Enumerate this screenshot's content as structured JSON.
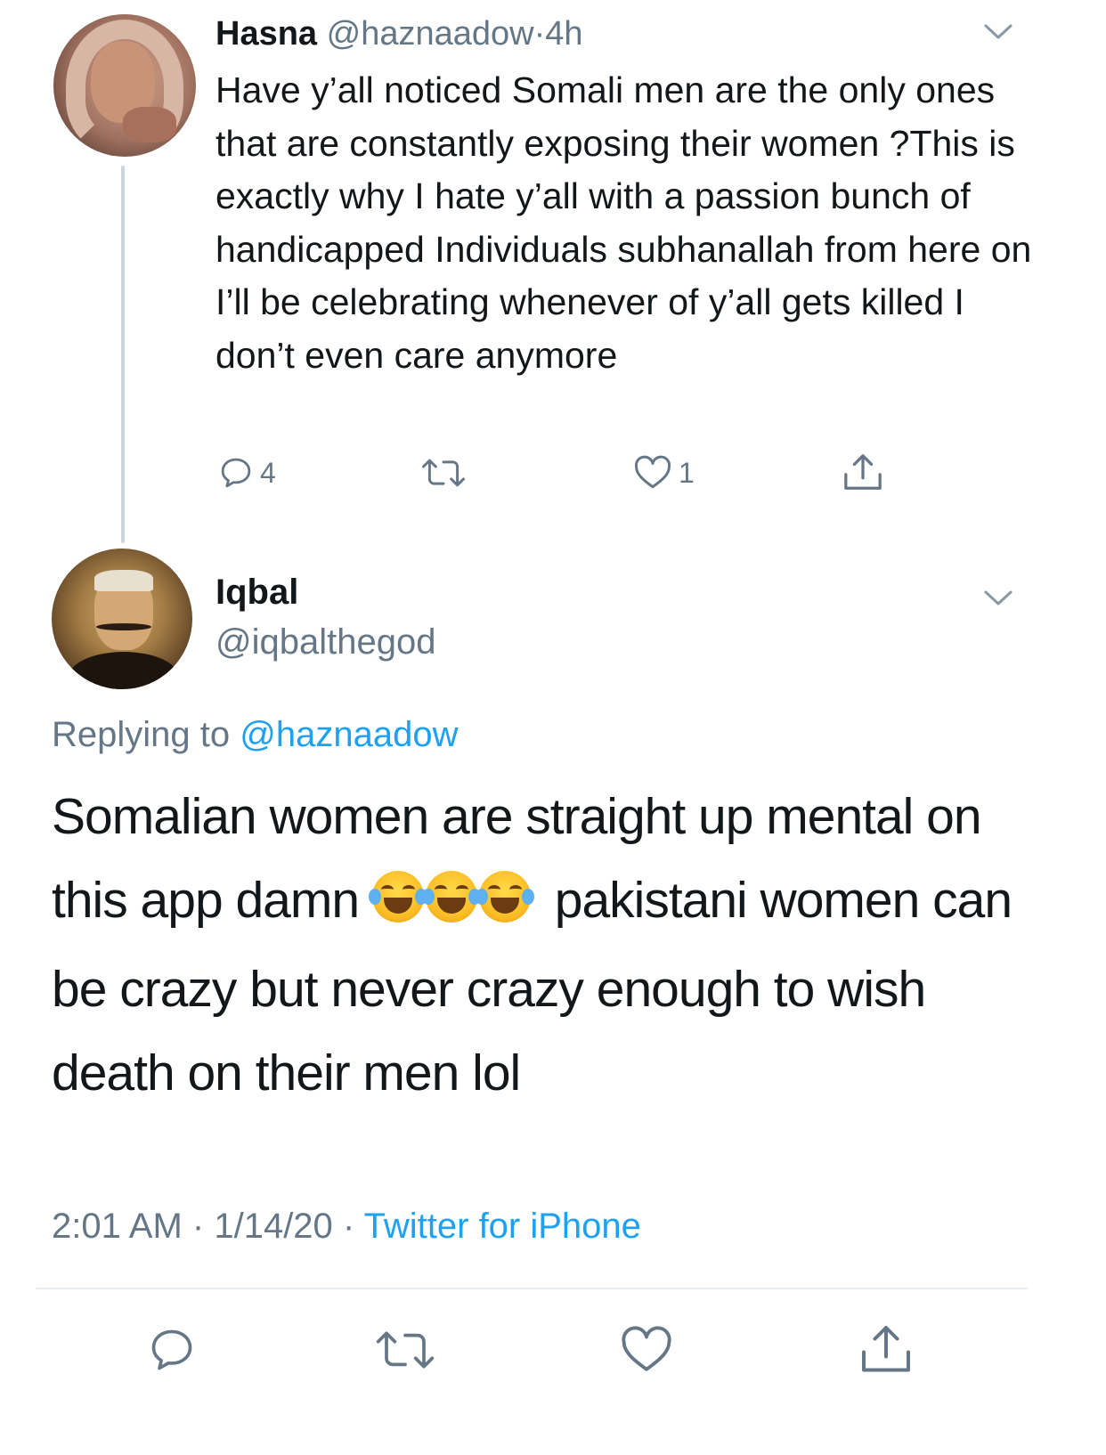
{
  "parent_tweet": {
    "author_name": "Hasna",
    "author_handle": "@haznaadow",
    "separator": "·",
    "time_ago": "4h",
    "text": "Have y’all noticed Somali men are the only ones that are constantly exposing their women ?This is exactly why I hate y’all with a passion bunch of handicapped Individuals subhanallah from here on I’ll be celebrating whenever of y’all gets killed I don’t even care anymore",
    "actions": {
      "reply_icon": "reply-icon",
      "reply_count": "4",
      "retweet_icon": "retweet-icon",
      "like_icon": "heart-icon",
      "like_count": "1",
      "share_icon": "share-icon"
    }
  },
  "reply_tweet": {
    "author_name": "Iqbal",
    "author_handle": "@iqbalthegod",
    "replying_to_label": "Replying to",
    "replying_to_handle": "@haznaadow",
    "text_before_emoji": "Somalian women are straight up mental on this app damn",
    "emoji": "😂😂😂",
    "text_after_emoji": "pakistani women can be crazy but never crazy enough to wish death on their men lol",
    "time": "2:01 AM",
    "date": "1/14/20",
    "dot": "·",
    "source": "Twitter for iPhone",
    "actions": {
      "reply_icon": "reply-icon",
      "retweet_icon": "retweet-icon",
      "like_icon": "heart-icon",
      "share_icon": "share-icon"
    }
  },
  "colors": {
    "text": "#14171a",
    "secondary": "#657786",
    "link": "#1da1f2",
    "divider": "#e6ecf0"
  }
}
